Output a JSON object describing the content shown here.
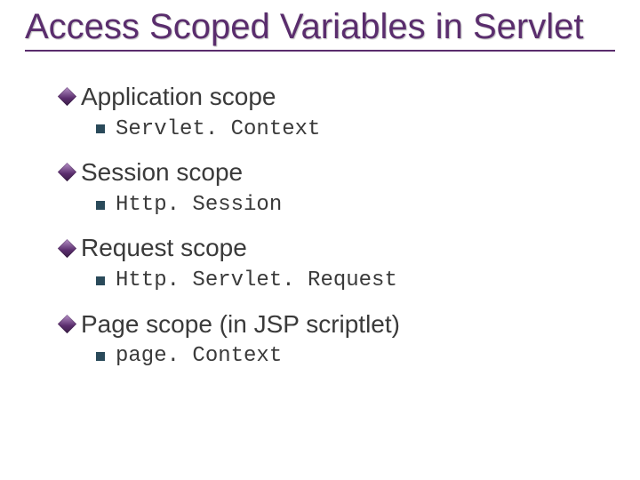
{
  "title": "Access Scoped Variables in Servlet",
  "items": [
    {
      "heading": "Application scope",
      "sub": "Servlet. Context"
    },
    {
      "heading": "Session scope",
      "sub": "Http. Session"
    },
    {
      "heading": "Request scope",
      "sub": "Http. Servlet. Request"
    },
    {
      "heading": "Page scope (in JSP scriptlet)",
      "sub": "page. Context"
    }
  ]
}
